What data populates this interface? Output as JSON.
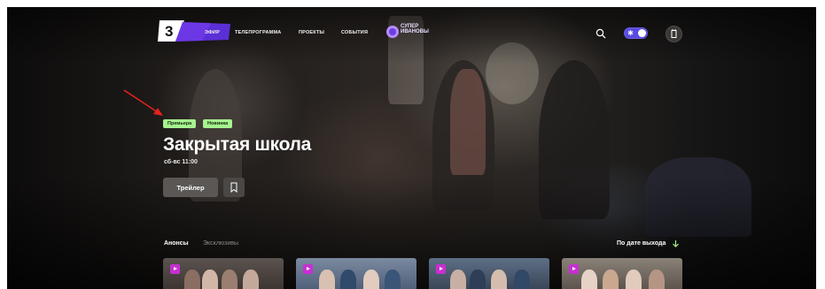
{
  "header": {
    "logo_mark": "3",
    "nav": [
      "Эфир",
      "Телепрограмма",
      "Проекты",
      "События"
    ],
    "brand_badge": "Супер\nИвановы",
    "icons": {
      "search": "search-icon",
      "theme": "sun-icon",
      "avatar": "user-icon"
    }
  },
  "hero": {
    "tags": [
      "Премьера",
      "Новинка"
    ],
    "title": "Закрытая школа",
    "schedule": "сб-вс 11:00",
    "trailer_label": "Трейлер",
    "bookmark_icon": "bookmark-icon"
  },
  "filters": {
    "tabs": [
      "Анонсы",
      "Эксклюзивы"
    ],
    "sort_label": "По дате выхода"
  },
  "colors": {
    "accent_purple": "#5a4be0",
    "tag_green": "#a6f38f",
    "play_magenta": "#c72fd1",
    "annotation_red": "#e3221c"
  }
}
